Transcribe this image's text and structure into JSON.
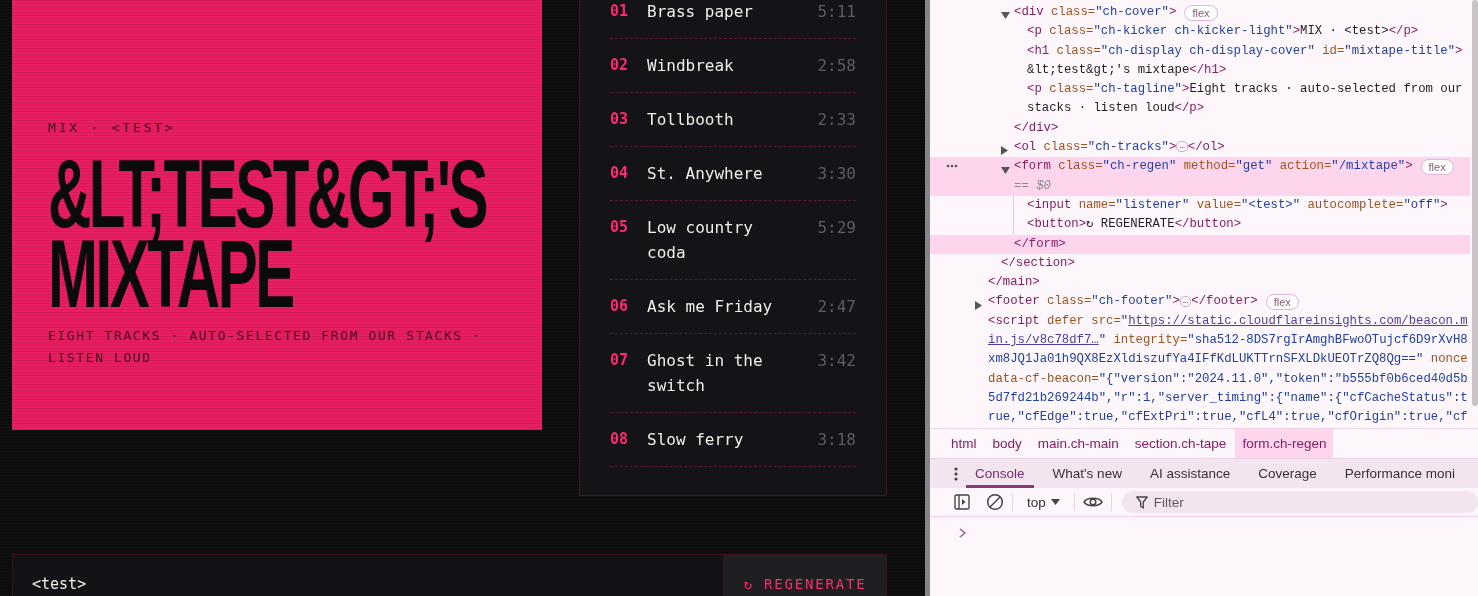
{
  "page": {
    "cover": {
      "kicker": "MIX · <TEST>",
      "title": "&LT;TEST&GT;'S MIXTAPE",
      "tagline": "EIGHT TRACKS · AUTO-SELECTED FROM OUR STACKS · LISTEN LOUD"
    },
    "tracks": [
      {
        "number": "01",
        "title": "Brass paper",
        "duration": "5:11"
      },
      {
        "number": "02",
        "title": "Windbreak",
        "duration": "2:58"
      },
      {
        "number": "03",
        "title": "Tollbooth",
        "duration": "2:33"
      },
      {
        "number": "04",
        "title": "St. Anywhere",
        "duration": "3:30"
      },
      {
        "number": "05",
        "title": "Low country coda",
        "duration": "5:29"
      },
      {
        "number": "06",
        "title": "Ask me Friday",
        "duration": "2:47"
      },
      {
        "number": "07",
        "title": "Ghost in the switch",
        "duration": "3:42"
      },
      {
        "number": "08",
        "title": "Slow ferry",
        "duration": "3:18"
      }
    ],
    "form": {
      "value": "<test>",
      "button": "↻ REGENERATE"
    }
  },
  "devtools": {
    "tree": [
      {
        "selected": false,
        "close": [
          {
            "kind": "tag",
            "text": "</main>"
          }
        ],
        "children": [
          {
            "selected": false,
            "close": [
              {
                "kind": "tag",
                "text": "</section>"
              }
            ],
            "children": [
              {
                "lines": [
                  [
                    {
                      "kind": "tag",
                      "text": "<div"
                    },
                    {
                      "kind": "attr",
                      "text": " class="
                    },
                    {
                      "kind": "value",
                      "text": "\"ch-cover\""
                    },
                    {
                      "kind": "tag",
                      "text": ">"
                    }
                  ]
                ],
                "expanded": true,
                "badge": "flex",
                "selected": false,
                "close": [
                  {
                    "kind": "tag",
                    "text": "</div>"
                  }
                ],
                "children": [
                  {
                    "lines": [
                      [
                        {
                          "kind": "tag",
                          "text": "<p"
                        },
                        {
                          "kind": "attr",
                          "text": " class="
                        },
                        {
                          "kind": "value",
                          "text": "\"ch-kicker ch-kicker-light\""
                        },
                        {
                          "kind": "tag",
                          "text": ">"
                        },
                        {
                          "kind": "text",
                          "text": "MIX · <test>"
                        },
                        {
                          "kind": "tag",
                          "text": "</p>"
                        }
                      ]
                    ],
                    "selected": false
                  },
                  {
                    "lines": [
                      [
                        {
                          "kind": "tag",
                          "text": "<h1"
                        },
                        {
                          "kind": "attr",
                          "text": " class="
                        },
                        {
                          "kind": "value",
                          "text": "\"ch-display ch-display-cover\""
                        },
                        {
                          "kind": "attr",
                          "text": " id="
                        },
                        {
                          "kind": "value",
                          "text": "\"mixtape-title\""
                        },
                        {
                          "kind": "tag",
                          "text": ">"
                        }
                      ],
                      [
                        {
                          "kind": "text",
                          "text": "&lt;test&gt;'s mixtape"
                        },
                        {
                          "kind": "tag",
                          "text": "</h1>"
                        }
                      ]
                    ],
                    "selected": false
                  },
                  {
                    "lines": [
                      [
                        {
                          "kind": "tag",
                          "text": "<p"
                        },
                        {
                          "kind": "attr",
                          "text": " class="
                        },
                        {
                          "kind": "value",
                          "text": "\"ch-tagline\""
                        },
                        {
                          "kind": "tag",
                          "text": ">"
                        },
                        {
                          "kind": "text",
                          "text": "Eight tracks · auto-selected from our"
                        }
                      ],
                      [
                        {
                          "kind": "text",
                          "text": "stacks · listen loud"
                        },
                        {
                          "kind": "tag",
                          "text": "</p>"
                        }
                      ]
                    ],
                    "selected": false
                  }
                ]
              },
              {
                "lines": [
                  [
                    {
                      "kind": "tag",
                      "text": "<ol"
                    },
                    {
                      "kind": "attr",
                      "text": " class="
                    },
                    {
                      "kind": "value",
                      "text": "\"ch-tracks\""
                    },
                    {
                      "kind": "tag",
                      "text": ">"
                    },
                    {
                      "kind": "pill",
                      "text": "…"
                    },
                    {
                      "kind": "tag",
                      "text": "</ol>"
                    }
                  ]
                ],
                "expanded": false,
                "selected": false
              },
              {
                "lines": [
                  [
                    {
                      "kind": "tag",
                      "text": "<form"
                    },
                    {
                      "kind": "attr",
                      "text": " class="
                    },
                    {
                      "kind": "value",
                      "text": "\"ch-regen\""
                    },
                    {
                      "kind": "attr",
                      "text": " method="
                    },
                    {
                      "kind": "value",
                      "text": "\"get\""
                    },
                    {
                      "kind": "attr",
                      "text": " action="
                    },
                    {
                      "kind": "value",
                      "text": "\"/mixtape\""
                    },
                    {
                      "kind": "tag",
                      "text": ">"
                    }
                  ],
                  [
                    {
                      "kind": "dim",
                      "text": "== $0"
                    }
                  ]
                ],
                "expanded": true,
                "badge": "flex",
                "selected": true,
                "close": [
                  {
                    "kind": "tag",
                    "text": "</form>"
                  }
                ],
                "children": [
                  {
                    "lines": [
                      [
                        {
                          "kind": "tag",
                          "text": "<input"
                        },
                        {
                          "kind": "attr",
                          "text": " name="
                        },
                        {
                          "kind": "value",
                          "text": "\"listener\""
                        },
                        {
                          "kind": "attr",
                          "text": " value="
                        },
                        {
                          "kind": "value",
                          "text": "\"<test>\""
                        },
                        {
                          "kind": "attr",
                          "text": " autocomplete="
                        },
                        {
                          "kind": "value",
                          "text": "\"off\""
                        },
                        {
                          "kind": "tag",
                          "text": ">"
                        }
                      ]
                    ],
                    "selected": false
                  },
                  {
                    "lines": [
                      [
                        {
                          "kind": "tag",
                          "text": "<button>"
                        },
                        {
                          "kind": "text",
                          "text": "↻ REGENERATE"
                        },
                        {
                          "kind": "tag",
                          "text": "</button>"
                        }
                      ]
                    ],
                    "selected": false
                  }
                ]
              }
            ]
          }
        ]
      },
      {
        "lines": [
          [
            {
              "kind": "tag",
              "text": "<footer"
            },
            {
              "kind": "attr",
              "text": " class="
            },
            {
              "kind": "value",
              "text": "\"ch-footer\""
            },
            {
              "kind": "tag",
              "text": ">"
            },
            {
              "kind": "pill",
              "text": "…"
            },
            {
              "kind": "tag",
              "text": "</footer>"
            }
          ]
        ],
        "expanded": false,
        "badge": "flex",
        "selected": false
      },
      {
        "lines": [
          [
            {
              "kind": "tag",
              "text": "<script"
            },
            {
              "kind": "attr",
              "text": " defer src="
            },
            {
              "kind": "value",
              "text": "\""
            },
            {
              "kind": "link",
              "text": "https://static.cloudflareinsights.com/beacon.m"
            }
          ],
          [
            {
              "kind": "link",
              "text": "in.js/v8c78df7…"
            },
            {
              "kind": "value",
              "text": "\""
            },
            {
              "kind": "attr",
              "text": " integrity="
            },
            {
              "kind": "value",
              "text": "\"sha512-8DS7rgIrAmghBFwoOTujcf6D9rXvH8"
            }
          ],
          [
            {
              "kind": "value",
              "text": "xm8JQ1Ja01h9QX8EzXldiszufYa4IFfKdLUKTTrnSFXLDkUEOTrZQ8Qg==\""
            },
            {
              "kind": "attr",
              "text": " nonce"
            }
          ],
          [
            {
              "kind": "attr",
              "text": "data-cf-beacon="
            },
            {
              "kind": "value",
              "text": "\"{\"version\":\"2024.11.0\",\"token\":\"b555bf0b6ced40d5b"
            }
          ],
          [
            {
              "kind": "value",
              "text": "5d7fd21b269244b\",\"r\":1,\"server_timing\":{\"name\":{\"cfCacheStatus\":t"
            }
          ],
          [
            {
              "kind": "value",
              "text": "rue,\"cfEdge\":true,\"cfExtPri\":true,\"cfL4\":true,\"cfOrigin\":true,\"cf"
            }
          ]
        ],
        "selected": false
      }
    ],
    "breadcrumbs": [
      {
        "label": "html",
        "selected": false
      },
      {
        "label": "body",
        "selected": false
      },
      {
        "label": "main.ch-main",
        "selected": false
      },
      {
        "label": "section.ch-tape",
        "selected": false
      },
      {
        "label": "form.ch-regen",
        "selected": true
      }
    ],
    "drawer": {
      "tabs": [
        {
          "label": "Console",
          "selected": true
        },
        {
          "label": "What's new",
          "selected": false
        },
        {
          "label": "AI assistance",
          "selected": false
        },
        {
          "label": "Coverage",
          "selected": false
        },
        {
          "label": "Performance moni",
          "selected": false
        }
      ],
      "context": "top",
      "filter_placeholder": "Filter"
    }
  }
}
